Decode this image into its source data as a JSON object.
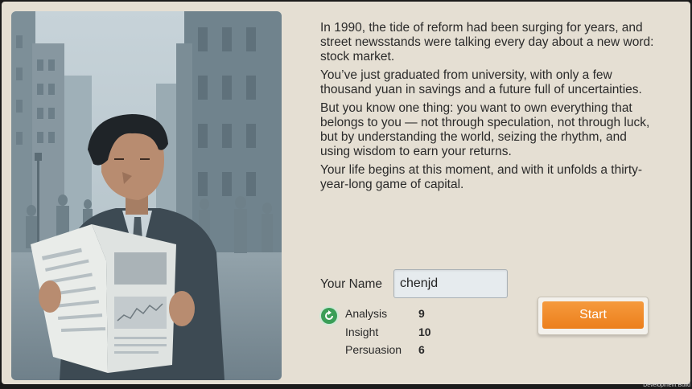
{
  "illustration": {
    "icon": "man-reading-newspaper-illustration"
  },
  "story": {
    "paragraphs": [
      "In 1990, the tide of reform had been surging for years, and street newsstands were talking every day about a new word: stock market.",
      "You’ve just graduated from university, with only a few thousand yuan in savings and a future full of uncertainties.",
      "But you know one thing: you want to own everything that belongs to you — not through speculation, not through luck, but by understanding the world, seizing the rhythm, and using wisdom to earn your returns.",
      "Your life begins at this moment, and with it unfolds a thirty-year-long game of capital."
    ]
  },
  "name_form": {
    "label": "Your Name",
    "value": "chenjd"
  },
  "reroll": {
    "icon": "refresh-icon",
    "color": "#3a9e57"
  },
  "stats": [
    {
      "name": "Analysis",
      "value": "9"
    },
    {
      "name": "Insight",
      "value": "10"
    },
    {
      "name": "Persuasion",
      "value": "6"
    }
  ],
  "start_button": {
    "label": "Start",
    "color": "#f08a2a"
  },
  "footer": {
    "dev_build": "Development Build"
  }
}
